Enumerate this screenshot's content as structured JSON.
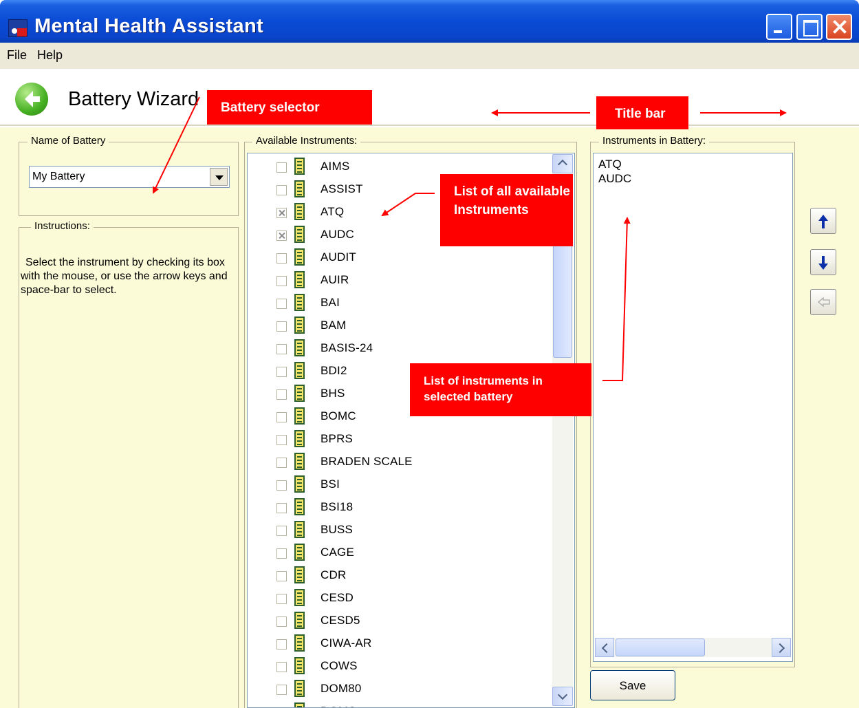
{
  "window": {
    "title": "Mental Health Assistant"
  },
  "menu": {
    "file": "File",
    "help": "Help"
  },
  "header": {
    "title": "Battery Wizard"
  },
  "name_group": {
    "label": "Name of Battery",
    "selected": "My Battery"
  },
  "instructions": {
    "label": "Instructions:",
    "text": "Select the instrument by checking its box with the mouse, or use the arrow keys and space-bar to select."
  },
  "available": {
    "label": "Available Instruments:",
    "items": [
      {
        "label": "AIMS",
        "checked": false
      },
      {
        "label": "ASSIST",
        "checked": false
      },
      {
        "label": "ATQ",
        "checked": true
      },
      {
        "label": "AUDC",
        "checked": true
      },
      {
        "label": "AUDIT",
        "checked": false
      },
      {
        "label": "AUIR",
        "checked": false
      },
      {
        "label": "BAI",
        "checked": false
      },
      {
        "label": "BAM",
        "checked": false
      },
      {
        "label": "BASIS-24",
        "checked": false
      },
      {
        "label": "BDI2",
        "checked": false
      },
      {
        "label": "BHS",
        "checked": false
      },
      {
        "label": "BOMC",
        "checked": false
      },
      {
        "label": "BPRS",
        "checked": false
      },
      {
        "label": "BRADEN SCALE",
        "checked": false
      },
      {
        "label": "BSI",
        "checked": false
      },
      {
        "label": "BSI18",
        "checked": false
      },
      {
        "label": "BUSS",
        "checked": false
      },
      {
        "label": "CAGE",
        "checked": false
      },
      {
        "label": "CDR",
        "checked": false
      },
      {
        "label": "CESD",
        "checked": false
      },
      {
        "label": "CESD5",
        "checked": false
      },
      {
        "label": "CIWA-AR",
        "checked": false
      },
      {
        "label": "COWS",
        "checked": false
      },
      {
        "label": "DOM80",
        "checked": false
      },
      {
        "label": "DOMS",
        "checked": false
      }
    ]
  },
  "battery": {
    "label": "Instruments in Battery:",
    "items": [
      "ATQ",
      "AUDC"
    ]
  },
  "save": {
    "label": "Save"
  },
  "annotations": {
    "battery_selector": "Battery selector",
    "title_bar": "Title bar",
    "available_list": "List of all available Instruments",
    "battery_list": "List of instruments in selected battery"
  }
}
